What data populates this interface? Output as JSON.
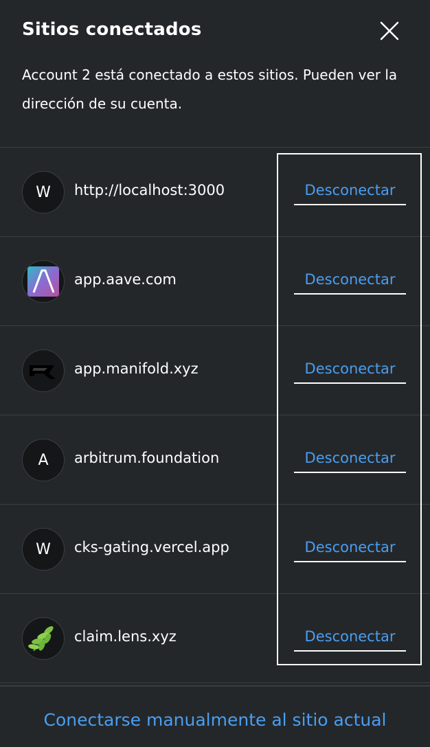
{
  "header": {
    "title": "Sitios conectados",
    "description": "Account 2 está conectado a estos sitios. Pueden ver la dirección de su cuenta."
  },
  "sites": [
    {
      "name": "http://localhost:3000",
      "avatar_letter": "W",
      "icon": "letter-avatar",
      "action": "Desconectar"
    },
    {
      "name": "app.aave.com",
      "avatar_letter": "",
      "icon": "aave-logo-icon",
      "action": "Desconectar"
    },
    {
      "name": "app.manifold.xyz",
      "avatar_letter": "",
      "icon": "manifold-logo-icon",
      "action": "Desconectar"
    },
    {
      "name": "arbitrum.foundation",
      "avatar_letter": "A",
      "icon": "letter-avatar",
      "action": "Desconectar"
    },
    {
      "name": "cks-gating.vercel.app",
      "avatar_letter": "W",
      "icon": "letter-avatar",
      "action": "Desconectar"
    },
    {
      "name": "claim.lens.xyz",
      "avatar_letter": "",
      "icon": "lens-leaf-icon",
      "action": "Desconectar"
    }
  ],
  "footer": {
    "manual_connect": "Conectarse manualmente al sitio actual"
  },
  "colors": {
    "background": "#24272a",
    "link": "#4a9ef1",
    "divider": "#3b3f43",
    "text": "#ffffff"
  }
}
